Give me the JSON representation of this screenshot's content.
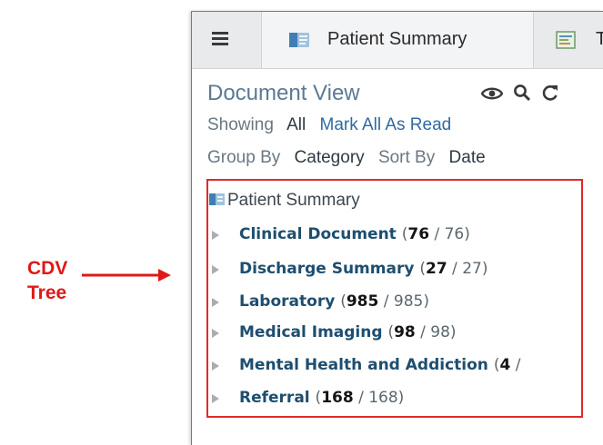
{
  "annotation": {
    "label_line1": "CDV",
    "label_line2": "Tree",
    "color": "#e01818"
  },
  "tabs": {
    "active_label": "Patient Summary",
    "second_label": "T"
  },
  "header": {
    "title": "Document View",
    "tools": [
      "eye-icon",
      "search-icon",
      "refresh-icon"
    ]
  },
  "filters": {
    "showing_label": "Showing",
    "showing_value": "All",
    "mark_all_read": "Mark All As Read",
    "group_by_label": "Group By",
    "group_by_value": "Category",
    "sort_by_label": "Sort By",
    "sort_by_value": "Date"
  },
  "tree": {
    "root_label": "Patient Summary",
    "nodes": [
      {
        "name": "Clinical Document",
        "open": "(",
        "unread": "76",
        "rest": " / 76)"
      },
      {
        "name": "Discharge Summary",
        "open": "(",
        "unread": "27",
        "rest": " / 27)"
      },
      {
        "name": "Laboratory",
        "open": "(",
        "unread": "985",
        "rest": " / 985)"
      },
      {
        "name": "Medical Imaging",
        "open": "(",
        "unread": "98",
        "rest": " / 98)"
      },
      {
        "name": "Mental Health and Addiction",
        "open": "(",
        "unread": "4",
        "rest": " /"
      },
      {
        "name": "Referral",
        "open": "(",
        "unread": "168",
        "rest": " / 168)"
      }
    ]
  },
  "colors": {
    "highlight_border": "#e02a2a",
    "node_text": "#1e4e6f",
    "link": "#2f6aa0"
  }
}
